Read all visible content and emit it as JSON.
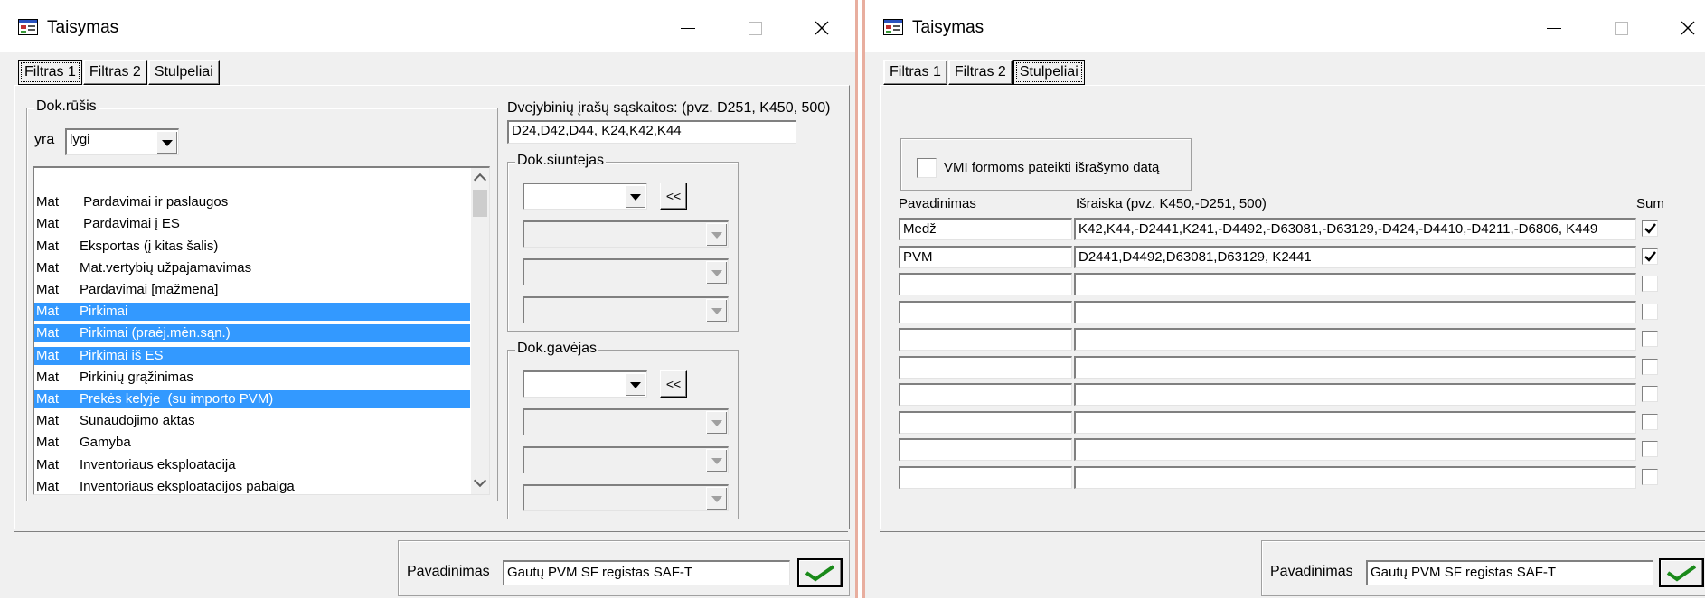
{
  "left": {
    "title": "Taisymas",
    "tabs": [
      {
        "label": "Filtras 1"
      },
      {
        "label": "Filtras 2"
      },
      {
        "label": "Stulpeliai"
      }
    ],
    "dok_rusis": {
      "group_title": "Dok.rūšis",
      "yra_label": "yra",
      "yra_value": "lygi",
      "items": [
        {
          "c1": "",
          "c2": "",
          "selected": false
        },
        {
          "c1": "Mat",
          "c2": " Pardavimai ir paslaugos",
          "selected": false
        },
        {
          "c1": "Mat",
          "c2": " Pardavimai į ES",
          "selected": false
        },
        {
          "c1": "Mat",
          "c2": "Eksportas (į kitas šalis)",
          "selected": false
        },
        {
          "c1": "Mat",
          "c2": "Mat.vertybių užpajamavimas",
          "selected": false
        },
        {
          "c1": "Mat",
          "c2": "Pardavimai [mažmena]",
          "selected": false
        },
        {
          "c1": "Mat",
          "c2": "Pirkimai",
          "selected": true
        },
        {
          "c1": "Mat",
          "c2": "Pirkimai (praėj.mėn.sąn.)",
          "selected": true
        },
        {
          "c1": "Mat",
          "c2": "Pirkimai iš ES",
          "selected": true
        },
        {
          "c1": "Mat",
          "c2": "Pirkinių grąžinimas",
          "selected": false
        },
        {
          "c1": "Mat",
          "c2": "Prekės kelyje  (su importo PVM)",
          "selected": true
        },
        {
          "c1": "Mat",
          "c2": "Sunaudojimo aktas",
          "selected": false
        },
        {
          "c1": "Mat",
          "c2": "Gamyba",
          "selected": false
        },
        {
          "c1": "Mat",
          "c2": "Inventoriaus eksploatacija",
          "selected": false
        },
        {
          "c1": "Mat",
          "c2": "Inventoriaus eksploatacijos pabaiga",
          "selected": false
        }
      ]
    },
    "accounts_label": "Dvejybinių įrašų sąskaitos: (pvz. D251, K450, 500)",
    "accounts_value": "D24,D42,D44, K24,K42,K44",
    "siuntejas_title": "Dok.siuntejas",
    "gavejas_title": "Dok.gavėjas",
    "arrow_button": "<<",
    "pavadinimas_label": "Pavadinimas",
    "pavadinimas_value": "Gautų PVM SF registas SAF-T"
  },
  "right": {
    "title": "Taisymas",
    "tabs": [
      {
        "label": "Filtras 1"
      },
      {
        "label": "Filtras 2"
      },
      {
        "label": "Stulpeliai"
      }
    ],
    "vmi_label": "VMI formoms pateikti išrašymo datą",
    "col_name": "Pavadinimas",
    "col_expr": "Išraiska (pvz. K450,-D251, 500)",
    "col_sum": "Sum",
    "rows": [
      {
        "name": "Medž",
        "expr": "K42,K44,-D2441,K241,-D4492,-D63081,-D63129,-D424,-D4410,-D4211,-D6806, K449",
        "sum": true
      },
      {
        "name": "PVM",
        "expr": "D2441,D4492,D63081,D63129, K2441",
        "sum": true
      },
      {
        "name": "",
        "expr": "",
        "sum": false
      },
      {
        "name": "",
        "expr": "",
        "sum": false
      },
      {
        "name": "",
        "expr": "",
        "sum": false
      },
      {
        "name": "",
        "expr": "",
        "sum": false
      },
      {
        "name": "",
        "expr": "",
        "sum": false
      },
      {
        "name": "",
        "expr": "",
        "sum": false
      },
      {
        "name": "",
        "expr": "",
        "sum": false
      },
      {
        "name": "",
        "expr": "",
        "sum": false
      }
    ],
    "pavadinimas_label": "Pavadinimas",
    "pavadinimas_value": "Gautų PVM SF registas SAF-T"
  },
  "colors": {
    "selection": "#3399ff",
    "window_bg": "#f0f0f0",
    "ok_check": "#1a8a1a"
  }
}
